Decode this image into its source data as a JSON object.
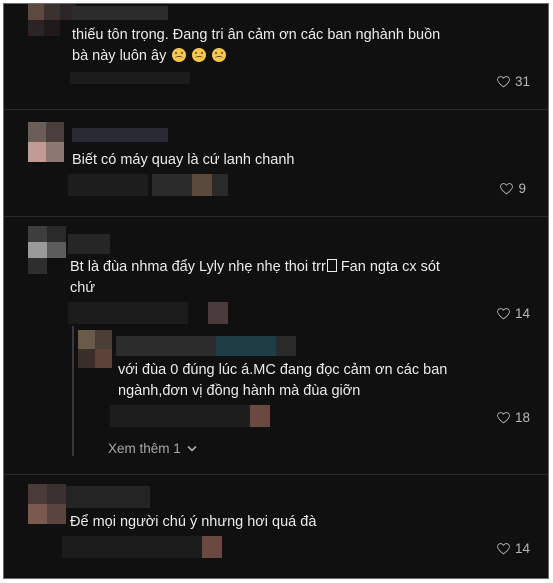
{
  "comments": [
    {
      "line1": "thiếu tôn trọng. Đang tri ân cảm ơn các ban nghành buồn",
      "line2": "bà này luôn ây",
      "emojis": [
        "sad-face",
        "sad-face",
        "sad-face"
      ],
      "likes": "31"
    },
    {
      "line1": "Biết có máy quay là cứ lanh chanh",
      "likes": "9"
    },
    {
      "line1": "Bt là đùa nhma đẩy Lyly nhẹ nhẹ thoi trr",
      "line1_after": "Fan ngta cx sót",
      "line2": "chứ",
      "likes": "14"
    },
    {
      "line1": "với đùa 0 đúng lúc á.MC đang đọc cảm ơn các ban",
      "line2": "ngành,đơn vị đồng hành mà đùa giỡn",
      "likes": "18"
    },
    {
      "line1": "Để mọi người chú ý nhưng hơi quá đà",
      "likes": "14"
    }
  ],
  "view_more": {
    "label": "Xem thêm 1",
    "icon": "chevron-down-icon"
  },
  "icons": {
    "like": "heart-outline-icon",
    "emoji": "sad-face-emoji",
    "missing_glyph": "unsupported-character-box"
  },
  "colors": {
    "background": "#101010",
    "text": "#ececec",
    "muted": "#b8b8b8",
    "border": "#6a6a6a"
  }
}
